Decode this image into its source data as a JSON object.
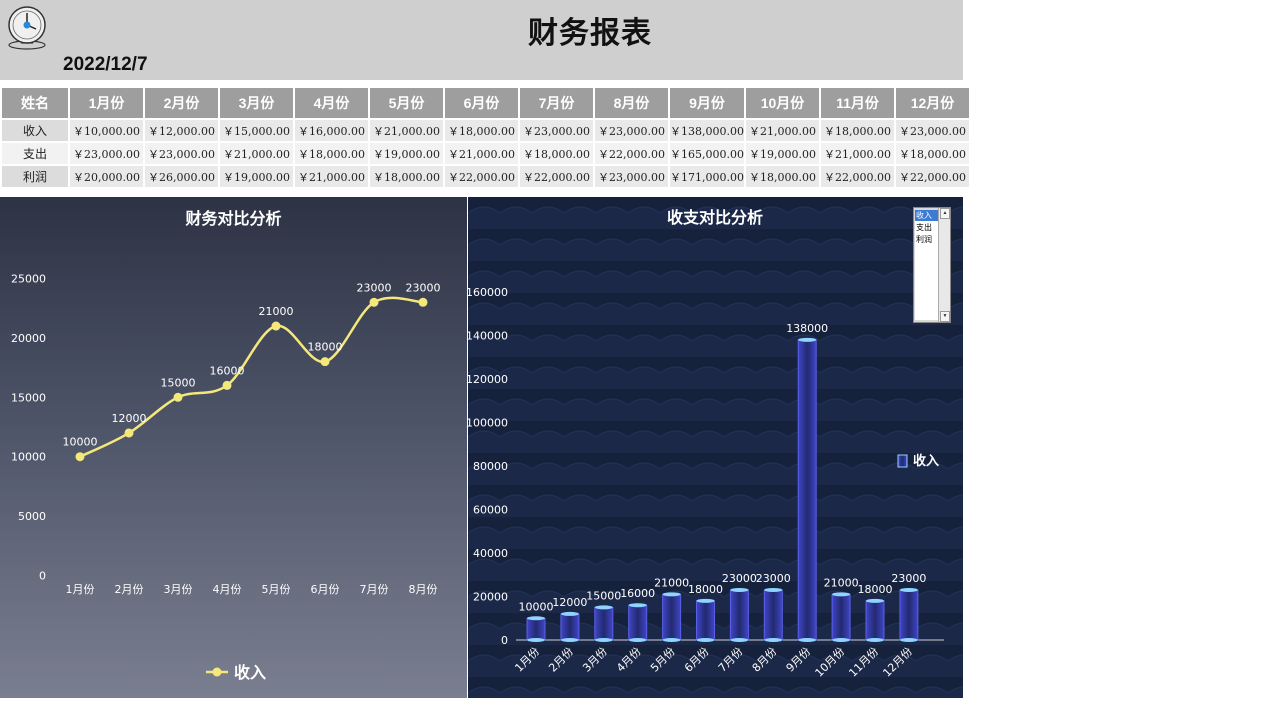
{
  "header": {
    "title": "财务报表",
    "date": "2022/12/7",
    "logo_icon": "clock-icon"
  },
  "table": {
    "columns": [
      "姓名",
      "1月份",
      "2月份",
      "3月份",
      "4月份",
      "5月份",
      "6月份",
      "7月份",
      "8月份",
      "9月份",
      "10月份",
      "11月份",
      "12月份"
    ],
    "rows": [
      {
        "name": "收入",
        "values": [
          "￥10,000.00",
          "￥12,000.00",
          "￥15,000.00",
          "￥16,000.00",
          "￥21,000.00",
          "￥18,000.00",
          "￥23,000.00",
          "￥23,000.00",
          "￥138,000.00",
          "￥21,000.00",
          "￥18,000.00",
          "￥23,000.00"
        ]
      },
      {
        "name": "支出",
        "values": [
          "￥23,000.00",
          "￥23,000.00",
          "￥21,000.00",
          "￥18,000.00",
          "￥19,000.00",
          "￥21,000.00",
          "￥18,000.00",
          "￥22,000.00",
          "￥165,000.00",
          "￥19,000.00",
          "￥21,000.00",
          "￥18,000.00"
        ]
      },
      {
        "name": "利润",
        "values": [
          "￥20,000.00",
          "￥26,000.00",
          "￥19,000.00",
          "￥21,000.00",
          "￥18,000.00",
          "￥22,000.00",
          "￥22,000.00",
          "￥23,000.00",
          "￥171,000.00",
          "￥18,000.00",
          "￥22,000.00",
          "￥22,000.00"
        ]
      }
    ]
  },
  "selector": {
    "options": [
      "收入",
      "支出",
      "利润"
    ],
    "selected": "收入"
  },
  "chart_data": [
    {
      "type": "line",
      "title": "财务对比分析",
      "categories": [
        "1月份",
        "2月份",
        "3月份",
        "4月份",
        "5月份",
        "6月份",
        "7月份",
        "8月份"
      ],
      "series": [
        {
          "name": "收入",
          "values": [
            10000,
            12000,
            15000,
            16000,
            21000,
            18000,
            23000,
            23000
          ],
          "color": "#f5e87a"
        }
      ],
      "yticks": [
        0,
        5000,
        10000,
        15000,
        20000,
        25000
      ],
      "ylim": [
        0,
        25000
      ],
      "legend": "bottom",
      "grid": false
    },
    {
      "type": "bar",
      "title": "收支对比分析",
      "categories": [
        "1月份",
        "2月份",
        "3月份",
        "4月份",
        "5月份",
        "6月份",
        "7月份",
        "8月份",
        "9月份",
        "10月份",
        "11月份",
        "12月份"
      ],
      "series": [
        {
          "name": "收入",
          "values": [
            10000,
            12000,
            15000,
            16000,
            21000,
            18000,
            23000,
            23000,
            138000,
            21000,
            18000,
            23000
          ],
          "color": "#4a4fd0"
        }
      ],
      "yticks": [
        0,
        20000,
        40000,
        60000,
        80000,
        100000,
        120000,
        140000,
        160000
      ],
      "ylim": [
        0,
        160000
      ],
      "legend": "right",
      "grid": false
    }
  ]
}
